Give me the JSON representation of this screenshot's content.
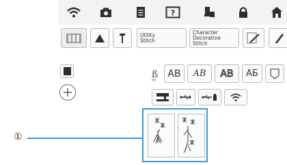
{
  "toolbar": {
    "icons": [
      "wifi-icon",
      "camera-icon",
      "document-icon",
      "help-icon",
      "thread-icon",
      "lock-icon",
      "home-icon"
    ]
  },
  "category_tabs": {
    "utility_label": "Utility\nStitch",
    "character_label": "Character\nDecorative\nStitch"
  },
  "font_row": {
    "partial_label": "ey",
    "items": [
      "AB",
      "AB",
      "AB",
      "АБ"
    ]
  },
  "callout": {
    "marker": "①"
  },
  "colors": {
    "accent": "#3b97d7",
    "topbar": "#f3f3f3"
  }
}
